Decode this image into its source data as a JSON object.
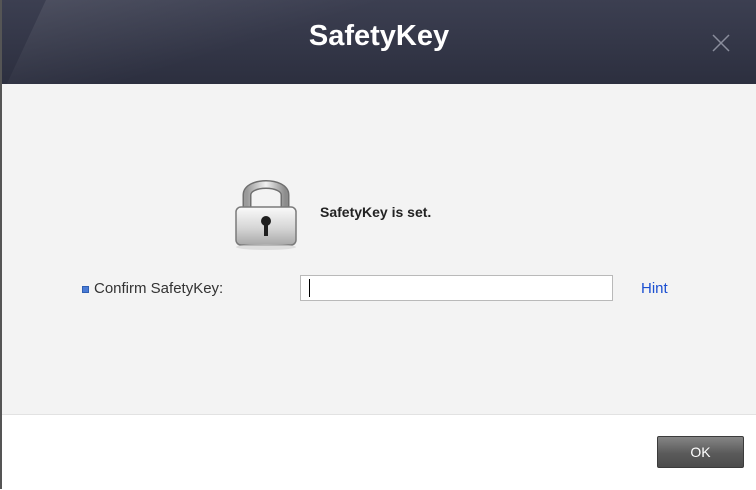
{
  "window": {
    "title": "SafetyKey"
  },
  "content": {
    "status_message": "SafetyKey is set.",
    "confirm_label": "Confirm SafetyKey:",
    "confirm_value": "",
    "hint_link": "Hint"
  },
  "footer": {
    "ok_label": "OK"
  },
  "icons": {
    "close": "close-icon",
    "lock": "padlock-icon",
    "bullet": "square-bullet-icon"
  },
  "colors": {
    "titlebar": "#2f3243",
    "hint_link": "#1b4fd1",
    "bullet": "#4a7bd6"
  }
}
